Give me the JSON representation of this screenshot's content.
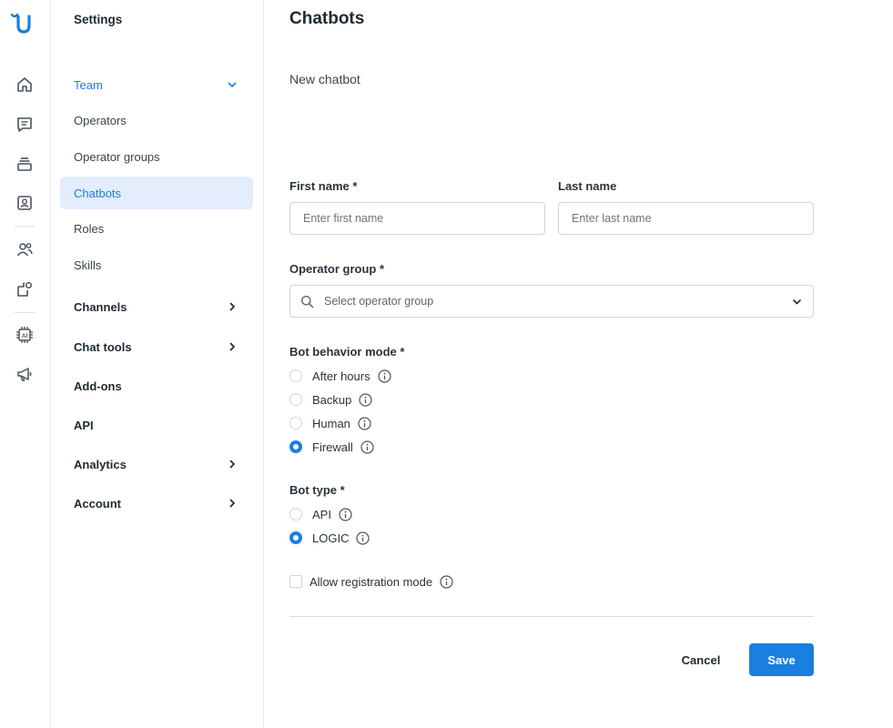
{
  "rail": {
    "icons": [
      "brand-logo-icon",
      "home-icon",
      "chat-icon",
      "inbox-stack-icon",
      "contacts-icon",
      "team-icon",
      "integrations-icon",
      "ai-chip-icon",
      "megaphone-icon"
    ]
  },
  "sidebar": {
    "title": "Settings",
    "items": [
      {
        "label": "Team"
      },
      {
        "label": "Operators"
      },
      {
        "label": "Operator groups"
      },
      {
        "label": "Chatbots"
      },
      {
        "label": "Roles"
      },
      {
        "label": "Skills"
      },
      {
        "label": "Channels"
      },
      {
        "label": "Chat tools"
      },
      {
        "label": "Add-ons"
      },
      {
        "label": "API"
      },
      {
        "label": "Analytics"
      },
      {
        "label": "Account"
      }
    ]
  },
  "main": {
    "title": "Chatbots",
    "subtitle": "New chatbot",
    "first_name": {
      "label": "First name *",
      "placeholder": "Enter first name",
      "value": ""
    },
    "last_name": {
      "label": "Last name",
      "placeholder": "Enter last name",
      "value": ""
    },
    "operator_group": {
      "label": "Operator group *",
      "placeholder": "Select operator group"
    },
    "behavior": {
      "label": "Bot behavior mode *",
      "options": [
        "After hours",
        "Backup",
        "Human",
        "Firewall"
      ],
      "selected": "Firewall"
    },
    "bot_type": {
      "label": "Bot type *",
      "options": [
        "API",
        "LOGIC"
      ],
      "selected": "LOGIC"
    },
    "registration": {
      "label": "Allow registration mode",
      "checked": false
    },
    "cancel_label": "Cancel",
    "save_label": "Save"
  },
  "colors": {
    "accent": "#1a7fe0",
    "active_bg": "#e3edfb",
    "text": "#222b33"
  }
}
